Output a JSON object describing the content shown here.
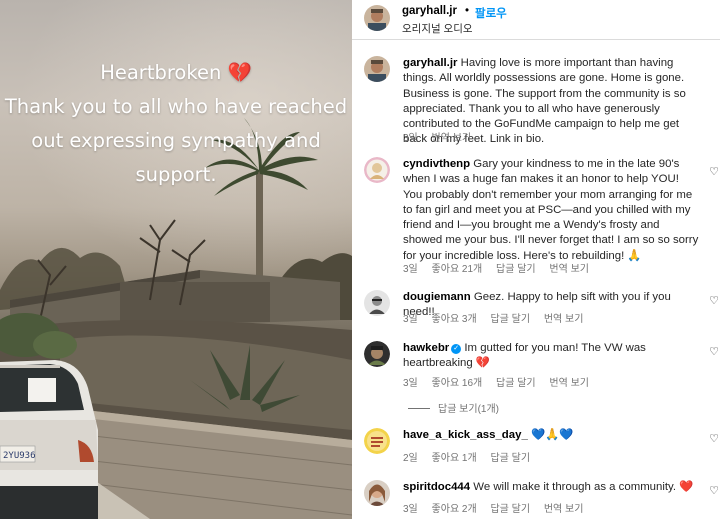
{
  "photo": {
    "caption_lines": [
      "Heartbroken 💔",
      "Thank you to all who have reached",
      "out expressing sympathy and",
      "support."
    ],
    "license_plate": "2YU936"
  },
  "header": {
    "username": "garyhall.jr",
    "dot": "•",
    "follow_label": "팔로우",
    "audio": "오리지널 오디오"
  },
  "icons": {
    "like": "heart-outline-icon",
    "verified": "verified-badge-icon"
  },
  "comments": [
    {
      "username": "garyhall.jr",
      "text": "Having love is more important than having things. All worldly possessions are gone. Home is gone. Business is gone. The support from the community is so appreciated. Thank you to all who have generously contributed to the GoFundMe campaign to help me get back on my feet. Link in bio.",
      "time": "3일",
      "translate": "번역 보기"
    },
    {
      "username": "cyndivthenp",
      "text": "Gary your kindness to me in the late 90's when I was a huge fan makes it an honor to help YOU! You probably don't remember your mom arranging for me to fan girl and meet you at PSC—and you chilled with my friend and I—you brought me a Wendy's frosty and showed me your bus. I'll never forget that! I am so so sorry for your incredible loss. Here's to rebuilding! 🙏",
      "time": "3일",
      "likes": "좋아요 21개",
      "reply": "답글 달기",
      "translate": "번역 보기"
    },
    {
      "username": "dougiemann",
      "text": "Geez. Happy to help sift with you if you need!!",
      "time": "3일",
      "likes": "좋아요 3개",
      "reply": "답글 달기",
      "translate": "번역 보기"
    },
    {
      "username": "hawkebr",
      "text": "Im gutted for you man! The VW was heartbreaking 💔",
      "time": "3일",
      "likes": "좋아요 16개",
      "reply": "답글 달기",
      "translate": "번역 보기",
      "view_replies": "답글 보기(1개)"
    },
    {
      "username": "have_a_kick_ass_day_",
      "text": "💙🙏💙",
      "time": "2일",
      "likes": "좋아요 1개",
      "reply": "답글 달기"
    },
    {
      "username": "spiritdoc444",
      "text": "We will make it through as a community. ❤️",
      "time": "3일",
      "likes": "좋아요 2개",
      "reply": "답글 달기",
      "translate": "번역 보기"
    }
  ],
  "colors": {
    "link_blue": "#0095f6",
    "meta_gray": "#737373",
    "divider": "#dbdbdb"
  }
}
